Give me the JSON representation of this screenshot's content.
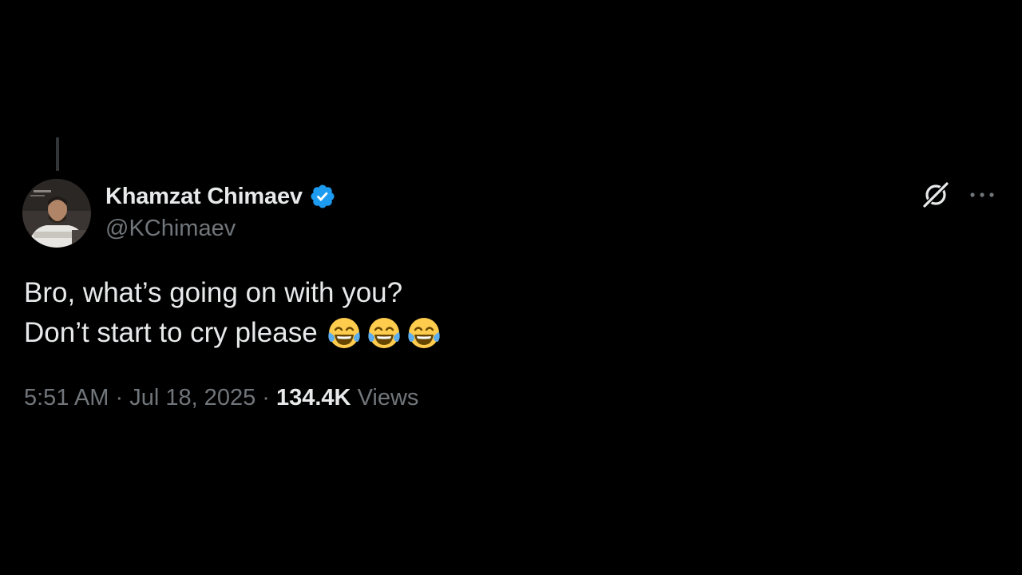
{
  "author": {
    "display_name": "Khamzat Chimaev",
    "handle": "@KChimaev",
    "verified": true,
    "verified_color": "#1d9bf0"
  },
  "tweet": {
    "line1": "Bro, what’s going on with you?",
    "line2": "Don’t start to cry please",
    "emojis": [
      "face-with-tears-of-joy",
      "face-with-tears-of-joy",
      "face-with-tears-of-joy"
    ]
  },
  "meta": {
    "time": "5:51 AM",
    "separator": "·",
    "date": "Jul 18, 2025",
    "views_count": "134.4K",
    "views_label": "Views"
  },
  "icons": {
    "grok": "grok-icon",
    "more": "more-icon"
  },
  "colors": {
    "background": "#000000",
    "primary_text": "#e7e9ea",
    "secondary_text": "#71767b",
    "thread_line": "#333639"
  }
}
